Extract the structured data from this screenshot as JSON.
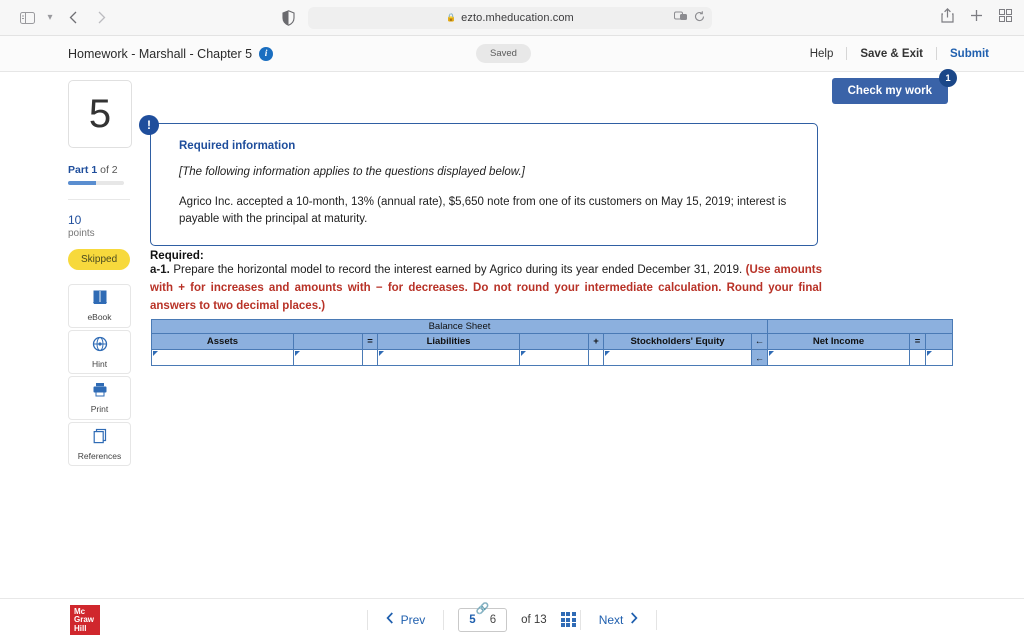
{
  "browser": {
    "url": "ezto.mheducation.com",
    "lock_icon": "lock-icon",
    "sidebar_icon": "sidebar-toggle-icon",
    "back_icon": "back-arrow-icon",
    "forward_icon": "forward-arrow-icon",
    "shield_icon": "shield-icon",
    "extensions_icon": "extensions-icon",
    "reload_icon": "reload-icon",
    "share_icon": "share-icon",
    "newtab_icon": "plus-icon",
    "tabs_icon": "tab-overview-icon"
  },
  "header": {
    "title": "Homework - Marshall - Chapter 5",
    "info_icon": "info-icon",
    "status": "Saved",
    "actions": {
      "help": "Help",
      "save_exit": "Save & Exit",
      "submit": "Submit"
    }
  },
  "check_my_work": {
    "label": "Check my work",
    "badge": "1"
  },
  "rail": {
    "question_number": "5",
    "part_prefix": "Part 1",
    "part_suffix": " of 2",
    "progress_percent": 50,
    "points_value": "10",
    "points_label": "points",
    "status_badge": "Skipped",
    "tools": [
      {
        "label": "eBook",
        "icon": "ebook-icon"
      },
      {
        "label": "Hint",
        "icon": "hint-icon"
      },
      {
        "label": "Print",
        "icon": "print-icon"
      },
      {
        "label": "References",
        "icon": "references-icon"
      }
    ]
  },
  "callout": {
    "bang_icon": "exclamation-icon",
    "heading": "Required information",
    "note": "[The following information applies to the questions displayed below.]",
    "body": "Agrico Inc. accepted a 10-month, 13% (annual rate), $5,650 note from one of its customers on May 15, 2019; interest is payable with the principal at maturity."
  },
  "required": {
    "heading": "Required:",
    "item_label": "a-1.",
    "item_text": " Prepare the horizontal model to record the interest earned by Agrico during its year ended December 31, 2019. ",
    "item_emphasis": "(Use amounts with + for increases and amounts with − for decreases. Do not round your intermediate calculation. Round your final answers to two decimal places.)"
  },
  "sheet": {
    "group_header": "Balance Sheet",
    "group_header_blank": "",
    "columns": [
      {
        "label": "Assets",
        "type": "header"
      },
      {
        "label": "",
        "type": "header-blank"
      },
      {
        "label": "=",
        "type": "operator"
      },
      {
        "label": "Liabilities",
        "type": "header"
      },
      {
        "label": "",
        "type": "header-blank"
      },
      {
        "label": "+",
        "type": "operator"
      },
      {
        "label": "Stockholders' Equity",
        "type": "header"
      },
      {
        "label": "←",
        "type": "operator"
      },
      {
        "label": "Net Income",
        "type": "header"
      },
      {
        "label": "=",
        "type": "operator"
      },
      {
        "label": "",
        "type": "header-blank"
      }
    ],
    "rows": [
      {
        "cells": [
          {
            "value": "",
            "kind": "input"
          },
          {
            "value": "",
            "kind": "input"
          },
          {
            "value": "",
            "kind": "spacer"
          },
          {
            "value": "",
            "kind": "input"
          },
          {
            "value": "",
            "kind": "input"
          },
          {
            "value": "",
            "kind": "spacer"
          },
          {
            "value": "",
            "kind": "input"
          },
          {
            "value": "←",
            "kind": "arrow"
          },
          {
            "value": "",
            "kind": "input"
          },
          {
            "value": "",
            "kind": "spacer"
          },
          {
            "value": "",
            "kind": "input"
          }
        ]
      }
    ]
  },
  "footer": {
    "logo_line1": "Mc",
    "logo_line2": "Graw",
    "logo_line3": "Hill",
    "prev": "Prev",
    "next": "Next",
    "page_current": "5",
    "page_linked": "6",
    "of_text": "of 13",
    "link_icon": "link-icon",
    "grid_icon": "grid-view-icon",
    "prev_icon": "chevron-left-icon",
    "next_icon": "chevron-right-icon"
  },
  "colors": {
    "accent_blue": "#1f5fae",
    "header_blue": "#8cb0de",
    "button_blue": "#3a63a8",
    "red_emphasis": "#b83227",
    "yellow_badge": "#f7d93c",
    "mgh_red": "#d0272d"
  }
}
